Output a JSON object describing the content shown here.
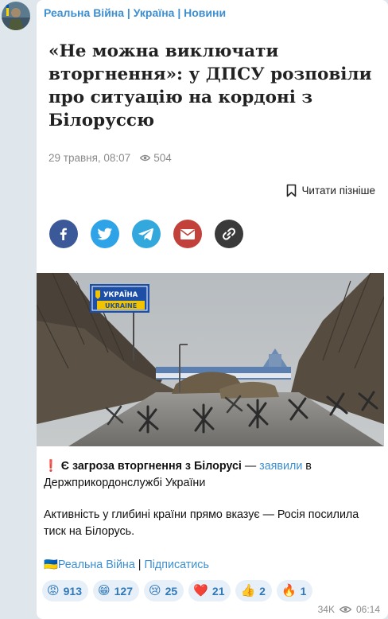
{
  "channel": {
    "name": "Реальна Війна | Україна | Новини"
  },
  "article": {
    "headline": "«Не можна виключати вторгнення»: у ДПСУ розповіли про ситуацію на кордоні з Білоруссю",
    "date": "29 травня, 08:07",
    "views": "504",
    "read_later": "Читати пізніше",
    "share_buttons": [
      "facebook-icon",
      "twitter-icon",
      "telegram-icon",
      "email-icon",
      "link-icon"
    ],
    "photo_sign_top": "УКРАЇНА",
    "photo_sign_bottom": "UKRAINE"
  },
  "post": {
    "line1_prefix": "❗",
    "line1_bold": "Є загроза вторгнення з Білорусі",
    "line1_mid": " — ",
    "line1_link": "заявили",
    "line1_suffix": " в Держприкордонслужбі України",
    "paragraph2": "Активність у глибині країни прямо вказує — Росія посилила тиск на Білорусь."
  },
  "signature": {
    "flag": "🇺🇦",
    "channel_link": "Реальна Війна",
    "separator": " | ",
    "subscribe_link": "Підписатись"
  },
  "reactions": [
    {
      "emoji": "😡",
      "count": "913"
    },
    {
      "emoji": "😁",
      "count": "127"
    },
    {
      "emoji": "😢",
      "count": "25"
    },
    {
      "emoji": "❤️",
      "count": "21"
    },
    {
      "emoji": "👍",
      "count": "2"
    },
    {
      "emoji": "🔥",
      "count": "1"
    }
  ],
  "footer": {
    "views": "34K",
    "time": "06:14"
  },
  "colors": {
    "accent": "#3d8fd1",
    "facebook": "#3b5998",
    "twitter": "#2fa3e8",
    "telegram": "#33a8dd",
    "email": "#c2413a",
    "link": "#3a3a3a"
  }
}
